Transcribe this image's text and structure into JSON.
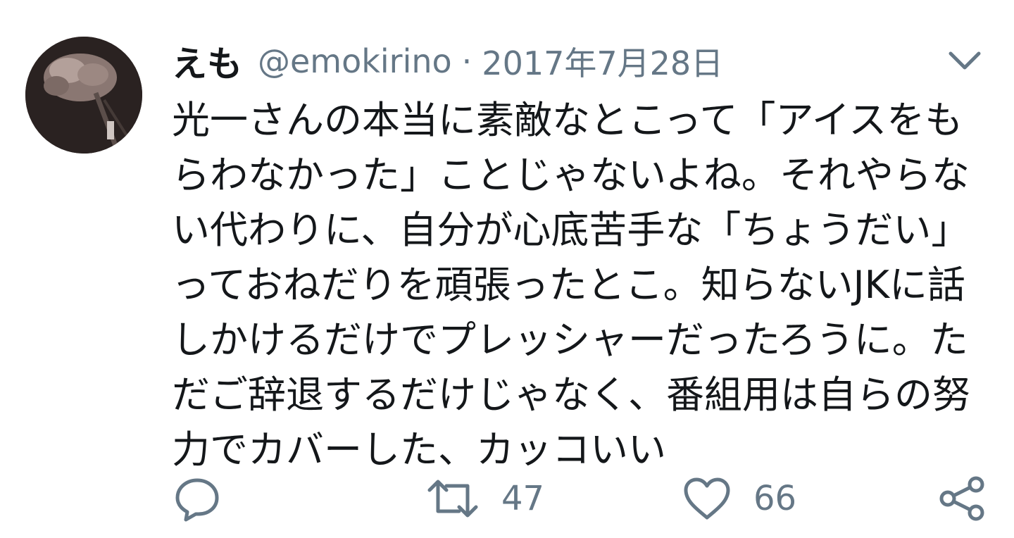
{
  "tweet": {
    "display_name": "えも",
    "handle": "@emokirino",
    "separator": "·",
    "date": "2017年7月28日",
    "text": "光一さんの本当に素敵なとこって「アイスをもらわなかった」ことじゃないよね。それやらない代わりに、自分が心底苦手な「ちょうだい」っておねだりを頑張ったとこ。知らないJKに話しかけるだけでプレッシャーだったろうに。ただご辞退するだけじゃなく、番組用は自らの努力でカバーした、カッコいい"
  },
  "actions": {
    "reply_icon": "speech-bubble-icon",
    "retweet_icon": "retweet-icon",
    "retweet_count": "47",
    "like_icon": "heart-icon",
    "like_count": "66",
    "share_icon": "share-icon"
  },
  "menu_icon": "chevron-down-icon",
  "colors": {
    "text": "#14171a",
    "secondary": "#657786",
    "background": "#ffffff"
  }
}
